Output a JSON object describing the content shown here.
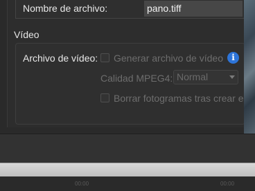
{
  "output": {
    "filename_label": "Nombre de archivo:",
    "filename_value": "pano.tiff"
  },
  "video": {
    "section_title": "Vídeo",
    "file_label": "Archivo de vídeo:",
    "generate_label": "Generar archivo de vídeo",
    "generate_checked": false,
    "quality_label": "Calidad MPEG4:",
    "quality_value": "Normal",
    "delete_frames_label": "Borrar fotogramas tras crear el",
    "delete_frames_checked": false,
    "info_icon": "info-icon"
  },
  "timeline": {
    "ticks": [
      "00:00",
      "00:00"
    ]
  },
  "colors": {
    "accent": "#2d74d8",
    "disabled_text": "#6d6d6d"
  }
}
